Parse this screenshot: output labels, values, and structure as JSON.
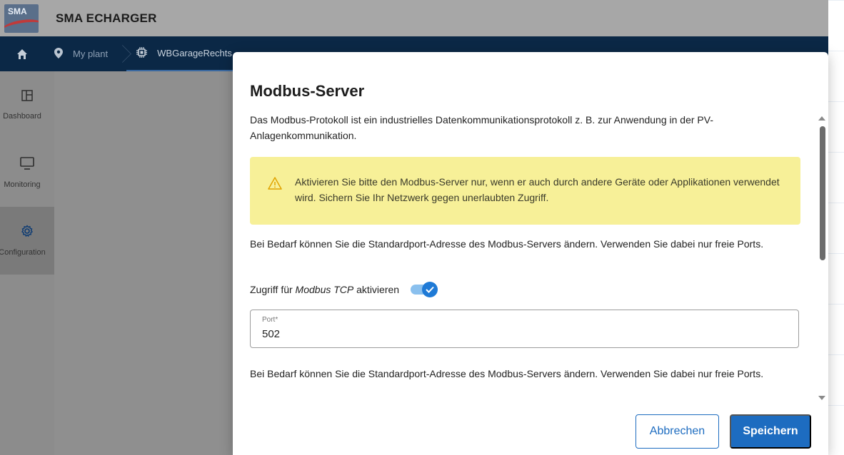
{
  "app": {
    "logo_text": "SMA",
    "title": "SMA ECHARGER"
  },
  "breadcrumb": [
    {
      "label": "My plant",
      "icon": "location-pin-icon"
    },
    {
      "label": "WBGarageRechts",
      "icon": "device-chip-icon"
    }
  ],
  "sidebar": {
    "items": [
      {
        "label": "Dashboard",
        "icon": "dashboard-icon"
      },
      {
        "label": "Monitoring",
        "icon": "monitor-icon"
      },
      {
        "label": "Configuration",
        "icon": "gear-icon",
        "active": true
      }
    ]
  },
  "modal": {
    "title": "Modbus-Server",
    "intro": "Das Modbus-Protokoll ist ein industrielles Datenkommunikationsprotokoll z. B. zur Anwendung in der PV-Anlagenkommunikation.",
    "alert": {
      "icon": "warning-icon",
      "text": "Aktivieren Sie bitte den Modbus-Server nur, wenn er auch durch andere Geräte oder Applikationen verwendet wird. Sichern Sie Ihr Netzwerk gegen unerlaubten Zugriff."
    },
    "port_info_1": "Bei Bedarf können Sie die Standardport-Adresse des Modbus-Servers ändern. Verwenden Sie dabei nur freie Ports.",
    "toggle": {
      "label_prefix": "Zugriff für ",
      "label_emphasis": "Modbus TCP",
      "label_suffix": " aktivieren",
      "checked": true
    },
    "port_field": {
      "label": "Port*",
      "value": "502"
    },
    "port_info_2": "Bei Bedarf können Sie die Standardport-Adresse des Modbus-Servers ändern. Verwenden Sie dabei nur freie Ports.",
    "cancel_label": "Abbrechen",
    "save_label": "Speichern"
  },
  "colors": {
    "primary": "#1d6cc0",
    "navbar": "#0b2846",
    "alert_bg": "#f7f098"
  }
}
